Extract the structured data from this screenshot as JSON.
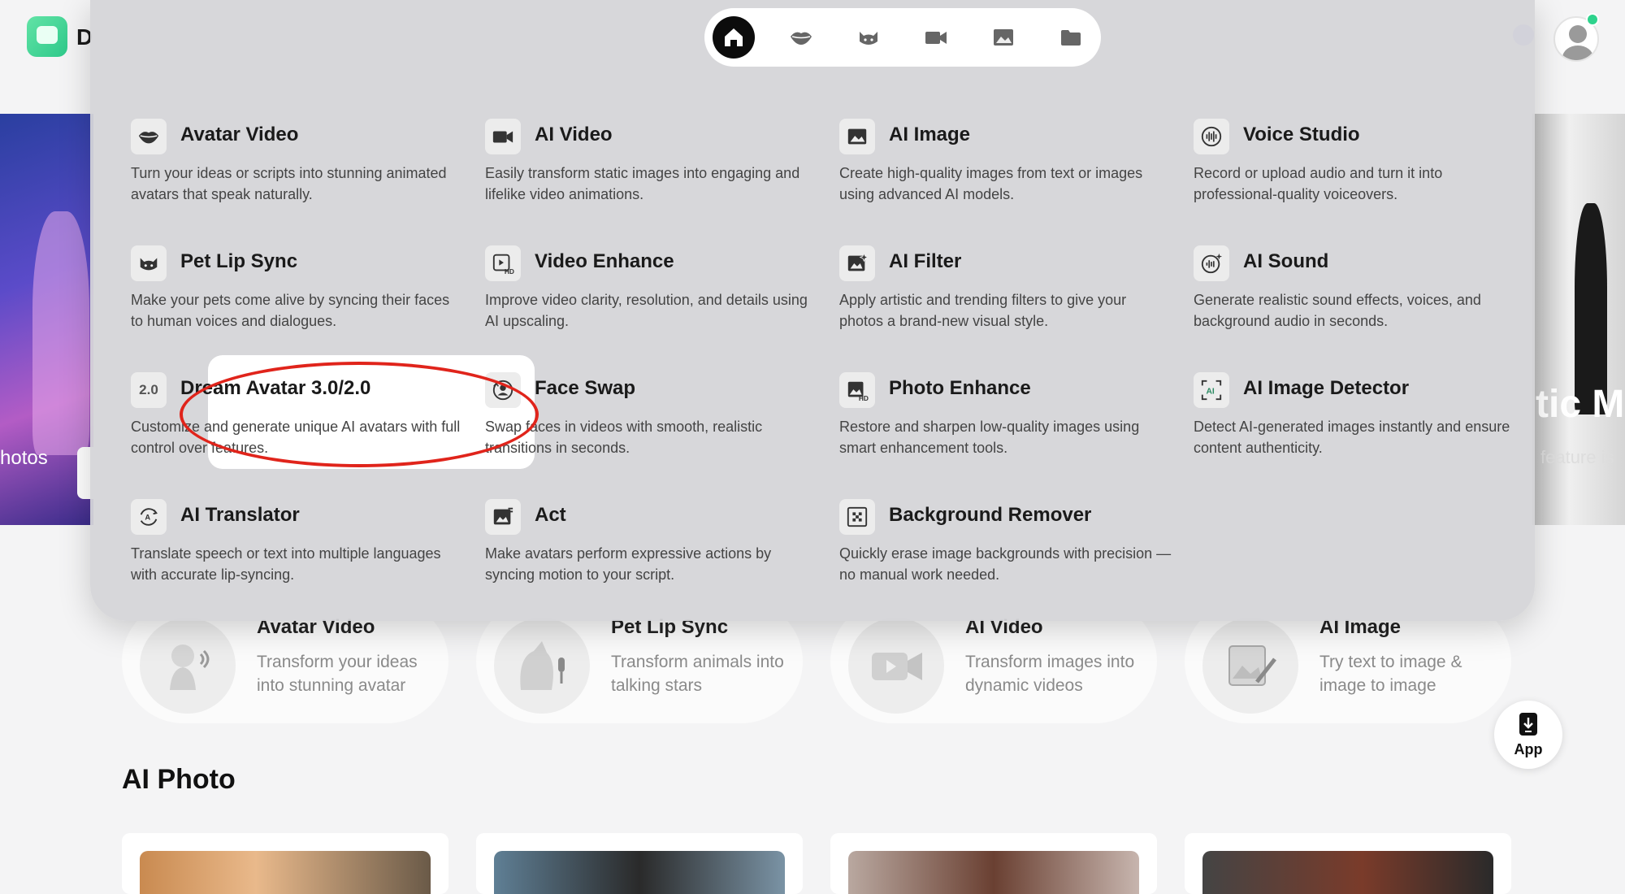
{
  "header": {
    "logo_letter": "D"
  },
  "hero": {
    "left_text": "hotos",
    "right_title": "tic M",
    "right_sub": "feature is"
  },
  "menu": {
    "nav": [
      {
        "icon": "home-icon",
        "active": true
      },
      {
        "icon": "lips-icon"
      },
      {
        "icon": "cat-icon"
      },
      {
        "icon": "video-camera-icon"
      },
      {
        "icon": "image-icon"
      },
      {
        "icon": "folder-icon"
      }
    ],
    "tools": [
      {
        "id": "avatar-video",
        "title": "Avatar Video",
        "desc": "Turn your ideas or scripts into stunning animated avatars that speak naturally.",
        "icon": "lips-icon"
      },
      {
        "id": "ai-video",
        "title": "AI Video",
        "desc": "Easily transform static images into engaging and lifelike video animations.",
        "icon": "video-camera-icon"
      },
      {
        "id": "ai-image",
        "title": "AI Image",
        "desc": "Create high-quality images from text or images using advanced AI models.",
        "icon": "image-icon"
      },
      {
        "id": "voice-studio",
        "title": "Voice Studio",
        "desc": "Record or upload audio and turn it into professional-quality voiceovers.",
        "icon": "sound-wave-icon"
      },
      {
        "id": "pet-lip-sync",
        "title": "Pet Lip Sync",
        "desc": "Make your pets come alive by syncing their faces to human voices and dialogues.",
        "icon": "cat-icon"
      },
      {
        "id": "video-enhance",
        "title": "Video Enhance",
        "desc": "Improve video clarity, resolution, and details using AI upscaling.",
        "icon": "hd-video-icon"
      },
      {
        "id": "ai-filter",
        "title": "AI Filter",
        "desc": "Apply artistic and trending filters to give your photos a brand-new visual style.",
        "icon": "sparkle-image-icon"
      },
      {
        "id": "ai-sound",
        "title": "AI Sound",
        "desc": "Generate realistic sound effects, voices, and background audio in seconds.",
        "icon": "sparkle-sound-icon"
      },
      {
        "id": "dream-avatar",
        "title": "Dream Avatar 3.0/2.0",
        "desc": "Customize and generate unique AI avatars with full control over features.",
        "badge": "2.0"
      },
      {
        "id": "face-swap",
        "title": "Face Swap",
        "desc": "Swap faces in videos with smooth, realistic transitions in seconds.",
        "icon": "face-swap-icon"
      },
      {
        "id": "photo-enhance",
        "title": "Photo Enhance",
        "desc": "Restore and sharpen low-quality images using smart enhancement tools.",
        "icon": "hd-image-icon"
      },
      {
        "id": "ai-image-detector",
        "title": "AI Image Detector",
        "desc": "Detect AI-generated images instantly and ensure content authenticity.",
        "icon": "ai-scan-icon"
      },
      {
        "id": "ai-translator",
        "title": "AI Translator",
        "desc": "Translate speech or text into multiple languages with accurate lip-syncing.",
        "icon": "translate-icon"
      },
      {
        "id": "act",
        "title": "Act",
        "desc": "Make avatars perform expressive actions by syncing motion to your script.",
        "icon": "motion-image-icon"
      },
      {
        "id": "background-remover",
        "title": "Background Remover",
        "desc": "Quickly erase image backgrounds with precision — no manual work needed.",
        "icon": "checker-image-icon"
      }
    ]
  },
  "feature_cards": [
    {
      "title": "Avatar Video",
      "desc": "Transform your ideas into stunning avatar"
    },
    {
      "title": "Pet Lip Sync",
      "desc": "Transform animals into talking stars"
    },
    {
      "title": "AI Video",
      "desc": "Transform images into dynamic videos"
    },
    {
      "title": "AI Image",
      "desc": "Try text to image & image to image"
    }
  ],
  "section": {
    "title": "AI Photo"
  },
  "app_button": {
    "label": "App"
  },
  "colors": {
    "highlight_ring": "#e0241b",
    "nav_active": "#0c0c0c",
    "brand_green": "#2ec98a"
  }
}
